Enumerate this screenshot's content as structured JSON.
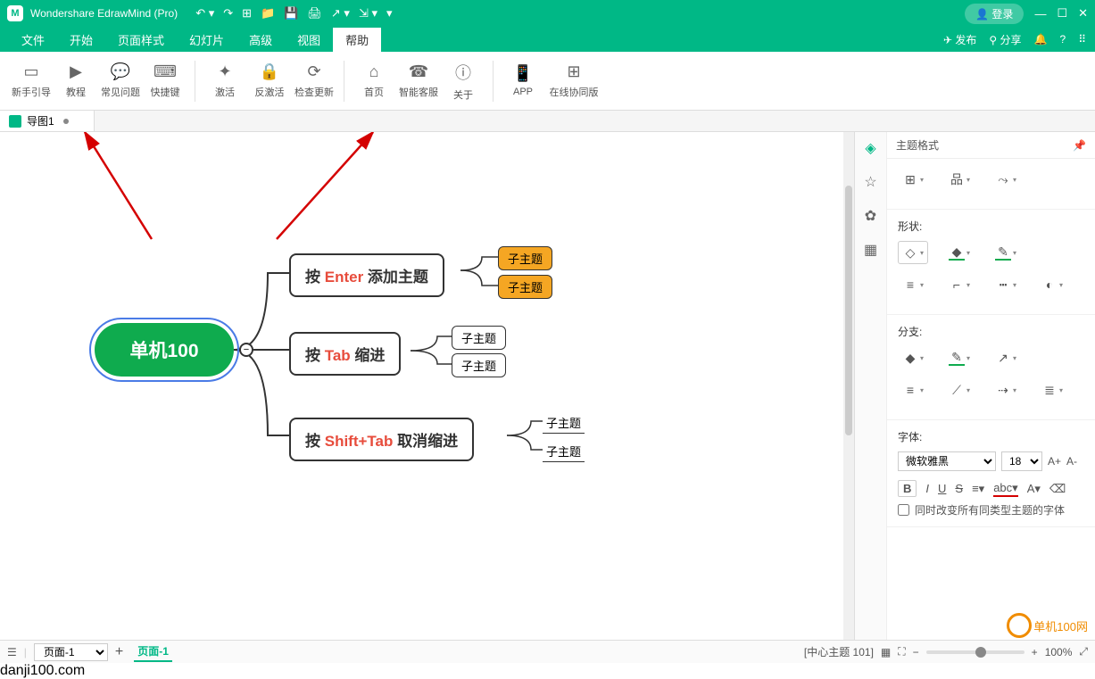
{
  "app_title": "Wondershare EdrawMind (Pro)",
  "login_label": "登录",
  "menu": [
    "文件",
    "开始",
    "页面样式",
    "幻灯片",
    "高级",
    "视图",
    "帮助"
  ],
  "menu_active": 6,
  "menu_right": {
    "publish": "发布",
    "share": "分享"
  },
  "ribbon": {
    "g1": [
      {
        "icon": "▭",
        "label": "新手引导"
      },
      {
        "icon": "▶",
        "label": "教程"
      },
      {
        "icon": "✉",
        "label": "常见问题"
      },
      {
        "icon": "⌨",
        "label": "快捷键"
      }
    ],
    "g2": [
      {
        "icon": "✦",
        "label": "激活"
      },
      {
        "icon": "🔒",
        "label": "反激活"
      },
      {
        "icon": "⟳",
        "label": "检查更新"
      }
    ],
    "g3": [
      {
        "icon": "⌂",
        "label": "首页"
      },
      {
        "icon": "☎",
        "label": "智能客服"
      },
      {
        "icon": "ⓘ",
        "label": "关于"
      }
    ],
    "g4": [
      {
        "icon": "📱",
        "label": "APP"
      },
      {
        "icon": "⊞",
        "label": "在线协同版"
      }
    ]
  },
  "doc_tab": "导图1",
  "mindmap": {
    "root": "单机100",
    "n1_pre": "按 ",
    "n1_hl": "Enter",
    "n1_post": " 添加主题",
    "n2_pre": "按 ",
    "n2_hl": "Tab",
    "n2_post": " 缩进",
    "n3_pre": "按 ",
    "n3_hl": "Shift+Tab",
    "n3_post": " 取消缩进",
    "sub": "子主题",
    "collapse": "−"
  },
  "right": {
    "title": "主题格式",
    "section_shape": "形状:",
    "section_branch": "分支:",
    "section_font": "字体:",
    "font_name": "微软雅黑",
    "font_size": "18",
    "bigger": "A+",
    "smaller": "A-",
    "bold": "B",
    "italic": "I",
    "underline": "U",
    "strike": "S",
    "checkbox": "同时改变所有同类型主题的字体"
  },
  "status": {
    "page_select": "页面-1",
    "page_tab": "页面-1",
    "info": "[中心主题 101]",
    "zoom": "100%"
  },
  "watermark": {
    "text": "单机100网",
    "url": "danji100.com"
  }
}
